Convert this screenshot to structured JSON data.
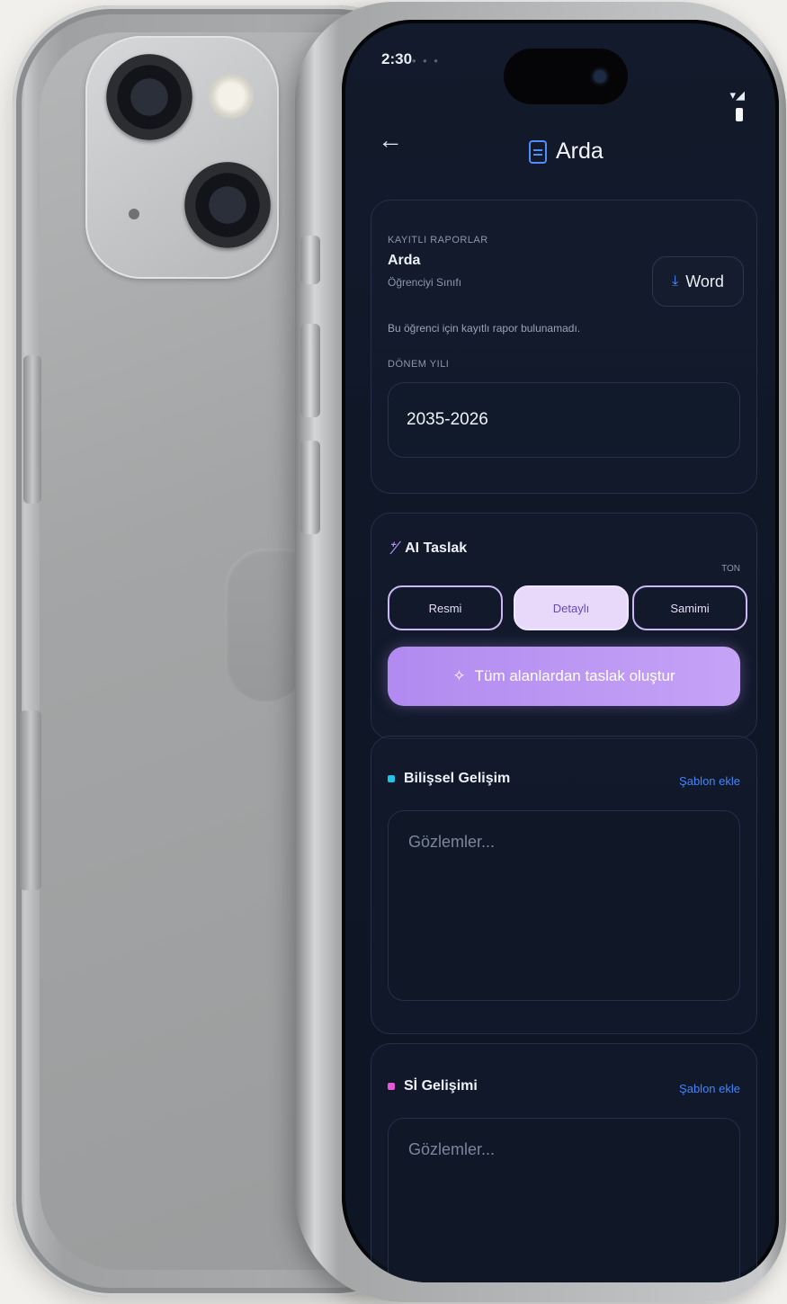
{
  "status_bar": {
    "time": "2:30",
    "dots": "• • •",
    "signal": "▾◢"
  },
  "header": {
    "title": "Arda"
  },
  "report_card": {
    "kicker": "KAYITLI RAPORLAR",
    "student_name": "Arda",
    "student_sub": "Öğrenciyi Sınıfı",
    "description": "Bu öğrenci için kayıtlı rapor bulunamadı.",
    "year_label": "DÖNEM YILI",
    "year_value": "2035-2026",
    "word_button": "Word"
  },
  "ai_card": {
    "title": "AI Taslak",
    "tone_label": "TON",
    "chips": [
      "Resmi",
      "Detaylı",
      "Samimi"
    ],
    "selected_chip": "Detaylı",
    "generate_button": "Tüm alanlardan taslak oluştur"
  },
  "sections": [
    {
      "title": "Bilişsel Gelişim",
      "link": "Şablon ekle",
      "placeholder": "Gözlemler...",
      "color": "#22c3e6"
    },
    {
      "title": "Sİ Gelişimi",
      "link": "Şablon ekle",
      "placeholder": "Gözlemler...",
      "color": "#e05ad8"
    }
  ],
  "colors": {
    "accent": "#b28af0",
    "link": "#3f86ff",
    "background": "#121a2b"
  }
}
